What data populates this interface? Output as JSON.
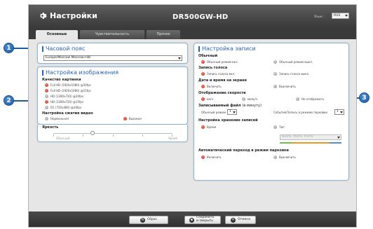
{
  "window": {
    "title": "Настройки",
    "model": "DR500GW-HD"
  },
  "language": {
    "label": "Язык :",
    "value": "RUS"
  },
  "tabs": [
    {
      "label": "Основные"
    },
    {
      "label": "Чувствительность"
    },
    {
      "label": "Прочее"
    }
  ],
  "timezone": {
    "title": "Часовой пояс",
    "value": "Europe/Moscow Moscow+08"
  },
  "image": {
    "title": "Настройка изображения",
    "quality_label": "Качество картинки",
    "quality_options": [
      "Full HD (1920x1080) @30fps",
      "Full HD (1920x1080) @15fps",
      "HD (1280x720) @30fps",
      "HD (1280x720) @15fps",
      "D1 (720x480) @30fps"
    ],
    "compression_label": "Настройка сжатия видео",
    "compression_options": [
      "Нормальная",
      "Высокая"
    ],
    "brightness_label": "Яркость",
    "brightness_min": "Обычный",
    "brightness_max": "Яркий",
    "brightness_level": 0.33
  },
  "recording": {
    "title": "Настройка записи",
    "normal_label": "Обычный",
    "normal_options": [
      "Обычный режим вкл.",
      "Обычный режим выкл."
    ],
    "voice_label": "Запись голоса",
    "voice_options": [
      "Запись голоса вкл.",
      "Запись голоса выкл."
    ],
    "datetime_label": "Дата и время на экране",
    "datetime_options": [
      "Включить",
      "Выключить"
    ],
    "speed_label": "Отображение скорости",
    "speed_options": [
      "км/ч",
      "миль/ч",
      "Не отображать"
    ],
    "file_label": "Записываемый файл",
    "file_note": "(в минуту)",
    "file_normal_label": "Обычный режим",
    "file_normal_value": "1",
    "file_event_label": "События/Запись в режиме парковки",
    "file_event_value": "1",
    "storage_label": "Настройка хранение записей",
    "storage_options": [
      "Время",
      "Тип"
    ],
    "storage_select": "N20%, P60%, P20%",
    "parking_label": "Автоматический переход в режим парковки",
    "parking_options": [
      "Включить",
      "Выключить"
    ]
  },
  "buttons": {
    "reset": "Сброс",
    "save": "Сохранить и закрыть",
    "cancel": "Отмена"
  },
  "callouts": [
    "1",
    "2",
    "3"
  ],
  "colors": {
    "accent": "#2b62a8",
    "radio_on": "#c8231a",
    "callout": "#1b5aa5"
  }
}
